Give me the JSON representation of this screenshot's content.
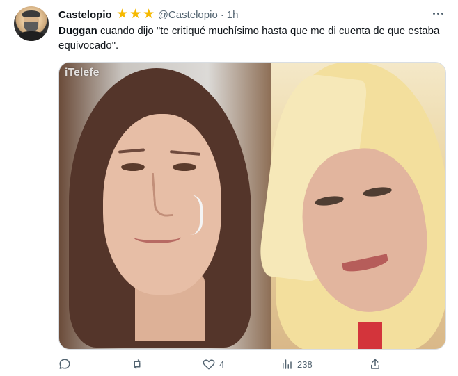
{
  "author": {
    "display_name": "Castelopio",
    "handle": "@Castelopio",
    "separator": "·",
    "timestamp": "1h",
    "badges": [
      "star-icon",
      "star-icon",
      "star-icon"
    ],
    "avatar_icon": "avatar"
  },
  "tweet": {
    "mention": "Duggan",
    "text": " cuando dijo \"te critiqué muchísimo hasta que me di cuenta de que estaba equivocado\"."
  },
  "media": {
    "watermark": "iTelefe"
  },
  "actions": {
    "reply_icon": "reply-icon",
    "retweet_icon": "retweet-icon",
    "like_icon": "heart-icon",
    "like_count": "4",
    "views_icon": "views-icon",
    "views_count": "238",
    "share_icon": "share-icon"
  },
  "colors": {
    "text_primary": "#0f1419",
    "text_secondary": "#536471",
    "star": "#f6b900",
    "border": "#d9dee3"
  }
}
